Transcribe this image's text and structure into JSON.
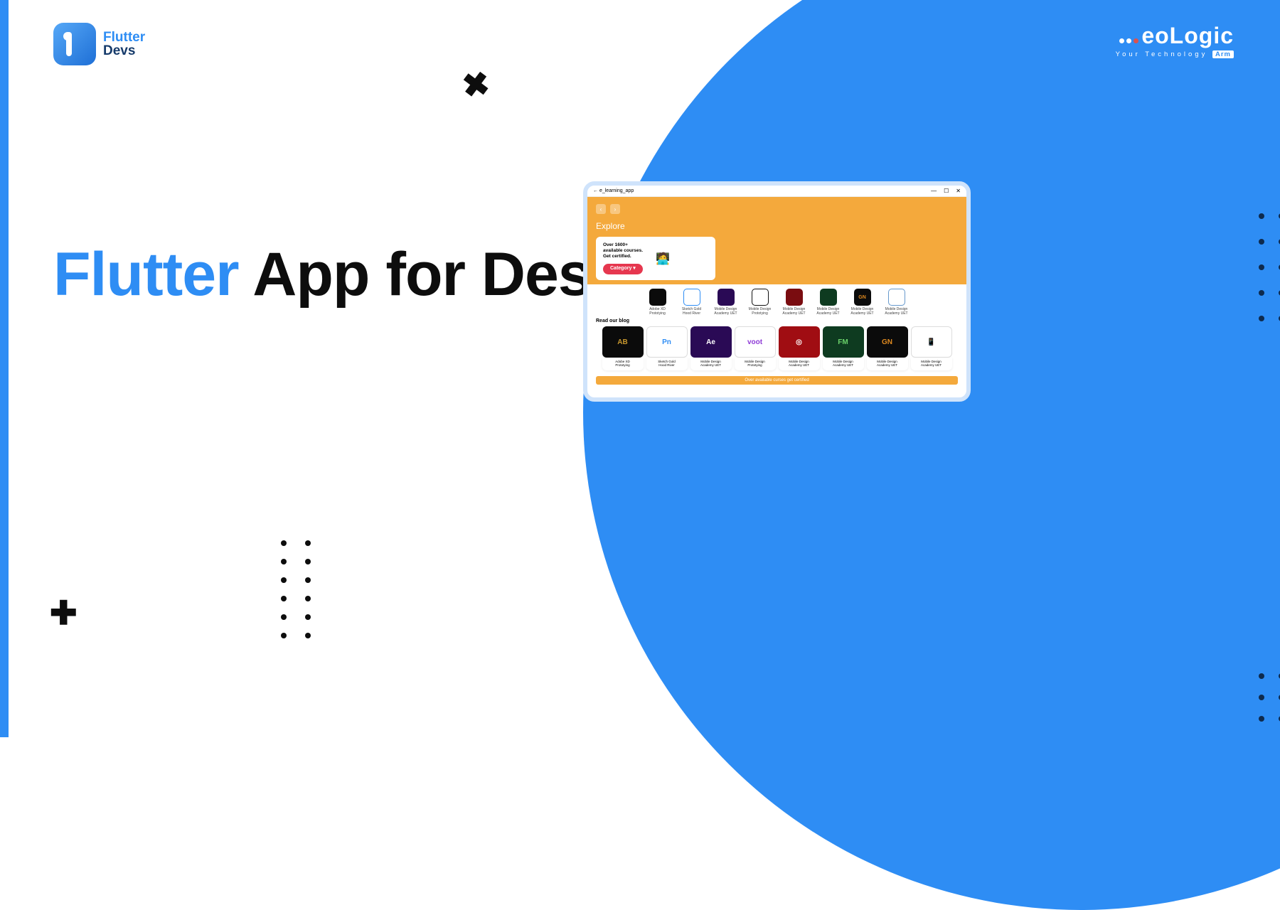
{
  "logo": {
    "t": "Flutter",
    "b": "Devs"
  },
  "heading": {
    "blue": "Flutter",
    "rest": " App for Desktop"
  },
  "aeo": {
    "brand": "eoLogic",
    "tag1": "Your Technology",
    "tag2": "Arm"
  },
  "app": {
    "title": "e_learning_app",
    "explore": "Explore",
    "promo": {
      "l1": "Over 1600+",
      "l2": "available courses.",
      "l3": "Get certified."
    },
    "category": "Category ▾",
    "row1": [
      {
        "l1": "Adobe XD",
        "l2": "Prototying",
        "bg": "#0b0b0b"
      },
      {
        "l1": "Sketch Gold",
        "l2": "Hood River",
        "bg": "#ffffff",
        "bd": "#2e8df4"
      },
      {
        "l1": "Mobile Design",
        "l2": "Academy UET",
        "bg": "#2a0a55"
      },
      {
        "l1": "Mobile Design",
        "l2": "Prototying",
        "bg": "#ffffff",
        "bd": "#111"
      },
      {
        "l1": "Mobile Design",
        "l2": "Academy UET",
        "bg": "#7a0c10"
      },
      {
        "l1": "Mobile Design",
        "l2": "Academy UET",
        "bg": "#0e3b20"
      },
      {
        "l1": "Mobile Design",
        "l2": "Academy UET",
        "bg": "#0b0b0b",
        "txt": "GN",
        "tc": "#e08a1f"
      },
      {
        "l1": "Mobile Design",
        "l2": "Academy UET",
        "bg": "#ffffff",
        "bd": "#69c"
      }
    ],
    "blog": "Read our blog",
    "row2": [
      {
        "l1": "Adobe XD",
        "l2": "Prototying",
        "bg": "#0b0b0b",
        "txt": "AB",
        "tc": "#c7972e"
      },
      {
        "l1": "Sketch Gold",
        "l2": "Hood River",
        "bg": "#ffffff",
        "txt": "Pn",
        "tc": "#2e8df4"
      },
      {
        "l1": "Mobile Design",
        "l2": "Academy UET",
        "bg": "#2a0a55",
        "txt": "Ae"
      },
      {
        "l1": "Mobile Design",
        "l2": "Prototying",
        "bg": "#ffffff",
        "txt": "voot",
        "tc": "#8e3bd6"
      },
      {
        "l1": "Mobile Design",
        "l2": "Academy UET",
        "bg": "#a00d12",
        "txt": "◎"
      },
      {
        "l1": "Mobile Design",
        "l2": "Academy UET",
        "bg": "#0e3b20",
        "txt": "FM",
        "tc": "#6ad06a"
      },
      {
        "l1": "Mobile Design",
        "l2": "Academy UET",
        "bg": "#0b0b0b",
        "txt": "GN",
        "tc": "#e08a1f"
      },
      {
        "l1": "Mobile Design",
        "l2": "Academy UET",
        "bg": "#ffffff",
        "txt": "📱",
        "tc": "#333"
      }
    ],
    "bottom": "Over available curses get certified"
  }
}
